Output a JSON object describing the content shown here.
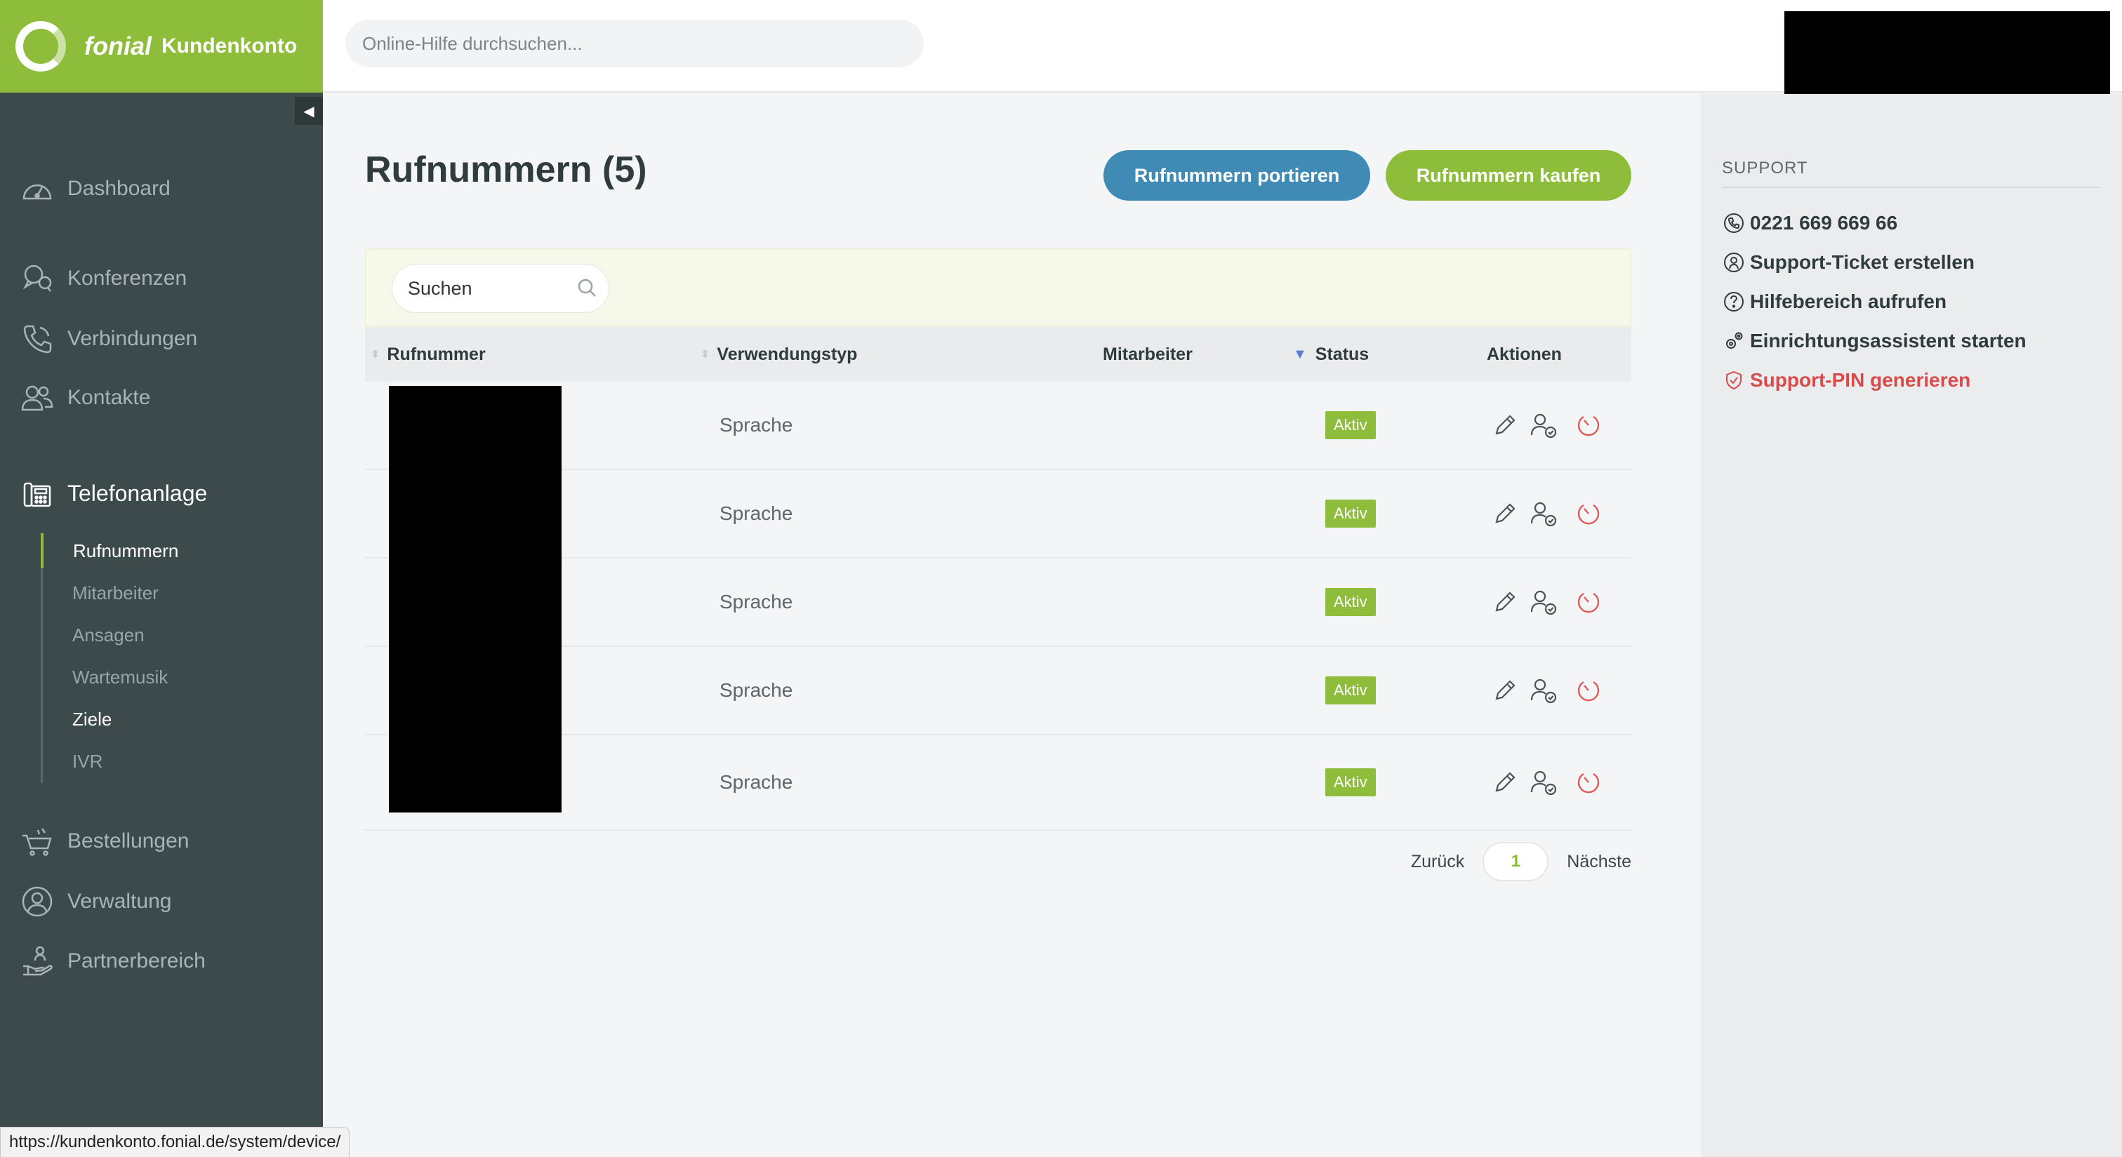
{
  "brand": {
    "name": "fonial",
    "product": "Kundenkonto"
  },
  "topbar": {
    "help_search_placeholder": "Online-Hilfe durchsuchen..."
  },
  "sidebar": {
    "collapse_glyph": "◀",
    "items": [
      {
        "label": "Dashboard",
        "icon": "speedometer-icon"
      },
      {
        "label": "Konferenzen",
        "icon": "conference-icon"
      },
      {
        "label": "Verbindungen",
        "icon": "phone-icon"
      },
      {
        "label": "Kontakte",
        "icon": "contacts-icon"
      },
      {
        "label": "Telefonanlage",
        "icon": "pbx-icon",
        "active": true
      },
      {
        "label": "Bestellungen",
        "icon": "cart-icon"
      },
      {
        "label": "Verwaltung",
        "icon": "user-circle-icon"
      },
      {
        "label": "Partnerbereich",
        "icon": "partner-icon"
      }
    ],
    "subitems": [
      {
        "label": "Rufnummern",
        "active": true
      },
      {
        "label": "Mitarbeiter"
      },
      {
        "label": "Ansagen"
      },
      {
        "label": "Wartemusik"
      },
      {
        "label": "Ziele",
        "active": true
      },
      {
        "label": "IVR"
      }
    ]
  },
  "main": {
    "title": "Rufnummern (5)",
    "port_button": "Rufnummern portieren",
    "buy_button": "Rufnummern kaufen",
    "table_search_label": "Suchen",
    "columns": {
      "number": "Rufnummer",
      "type": "Verwendungstyp",
      "employee": "Mitarbeiter",
      "status": "Status",
      "actions": "Aktionen"
    },
    "rows": [
      {
        "type": "Sprache",
        "status": "Aktiv"
      },
      {
        "type": "Sprache",
        "status": "Aktiv"
      },
      {
        "type": "Sprache",
        "status": "Aktiv"
      },
      {
        "type": "Sprache",
        "status": "Aktiv"
      },
      {
        "type": "Sprache",
        "status": "Aktiv"
      }
    ],
    "pagination": {
      "prev": "Zurück",
      "page": "1",
      "next": "Nächste"
    }
  },
  "support": {
    "title": "SUPPORT",
    "items": [
      {
        "label": "0221 669 669 66",
        "icon": "phone-icon"
      },
      {
        "label": "Support-Ticket erstellen",
        "icon": "ticket-icon"
      },
      {
        "label": "Hilfebereich aufrufen",
        "icon": "help-icon"
      },
      {
        "label": "Einrichtungsassistent starten",
        "icon": "gears-icon"
      },
      {
        "label": "Support-PIN generieren",
        "icon": "shield-icon"
      }
    ]
  },
  "statusbar": {
    "url": "https://kundenkonto.fonial.de/system/device/"
  },
  "colors": {
    "brand_green": "#8dbd3a",
    "sidebar_bg": "#3c4a4c",
    "port_blue": "#3f8bb5",
    "danger_red": "#d94a4a"
  }
}
